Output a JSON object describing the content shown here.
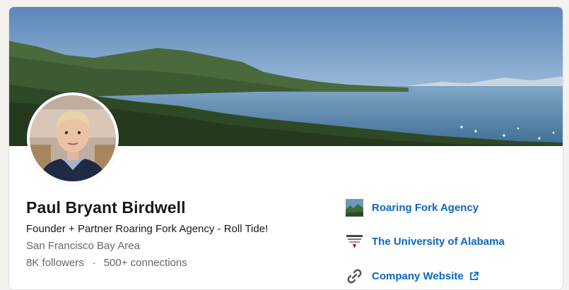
{
  "profile": {
    "name": "Paul Bryant Birdwell",
    "headline": "Founder + Partner Roaring Fork Agency - Roll Tide!",
    "location": "San Francisco Bay Area",
    "followers": "8K followers",
    "separator": "·",
    "connections": "500+ connections"
  },
  "sidebar": {
    "company": {
      "label": "Roaring Fork Agency",
      "icon": "roaring-fork-logo"
    },
    "education": {
      "label": "The University of Alabama",
      "icon": "alabama-logo"
    },
    "website": {
      "label": "Company Website",
      "icon": "link-icon",
      "external_icon": "external-link-icon"
    }
  },
  "colors": {
    "link": "#0a66c2",
    "text_primary": "#191919",
    "text_secondary": "#666666"
  }
}
